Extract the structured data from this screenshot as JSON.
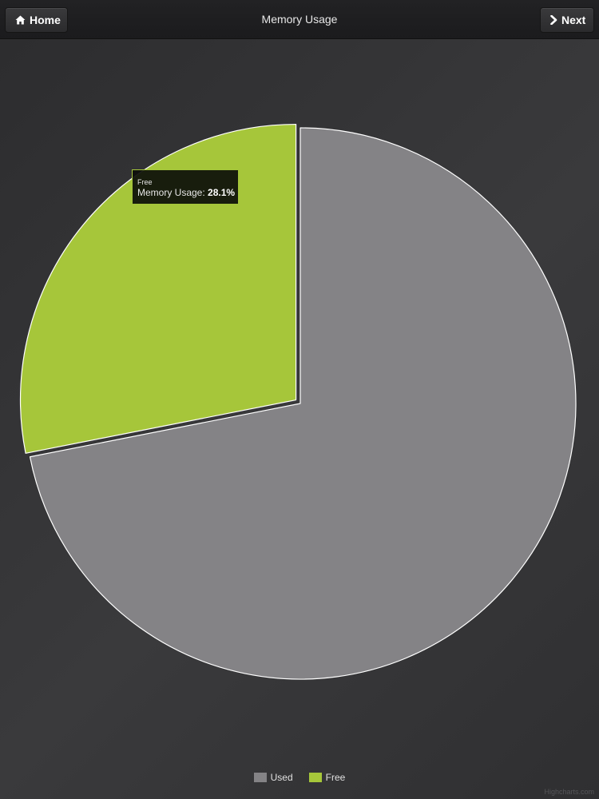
{
  "header": {
    "home_label": "Home",
    "next_label": "Next",
    "title": "Memory Usage",
    "home_icon": "home-icon",
    "next_icon": "chevron-right-icon"
  },
  "chart_data": {
    "type": "pie",
    "series_name": "Memory Usage",
    "slices": [
      {
        "name": "Used",
        "value": 71.9,
        "color": "#848386"
      },
      {
        "name": "Free",
        "value": 28.1,
        "color": "#a6c63a",
        "sliced": true
      }
    ],
    "tooltip": {
      "series_label": "Free",
      "text": "Memory Usage: ",
      "value": "28.1%"
    },
    "legend": {
      "position": "bottom-center"
    }
  },
  "credits": "Highcharts.com"
}
